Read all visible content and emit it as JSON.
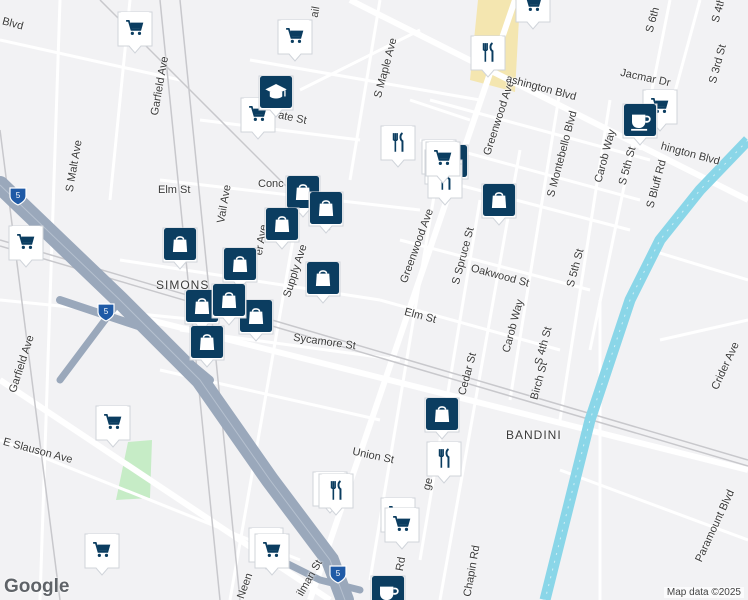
{
  "map": {
    "colors": {
      "background": "#f2f2f4",
      "road": "#ffffff",
      "freeway": "#9aa8bb",
      "river": "#8ad6e8",
      "park": "#c6ecc6",
      "highlight": "#f4e6b0",
      "pin_bg": "#0b3d60"
    },
    "streets": [
      {
        "name": "Garfield Ave",
        "rot": -80
      },
      {
        "name": "S Malt Ave",
        "rot": -80
      },
      {
        "name": "Vail Ave",
        "rot": -80
      },
      {
        "name": "Elm St",
        "rot": 0
      },
      {
        "name": "Conc",
        "rot": 0
      },
      {
        "name": "er Ave",
        "rot": -80
      },
      {
        "name": "Supply Ave",
        "rot": -72
      },
      {
        "name": "Sycamore St",
        "rot": 8
      },
      {
        "name": "Garfield Ave",
        "rot": -72
      },
      {
        "name": "E Slauson Ave",
        "rot": 15
      },
      {
        "name": "S Maple Ave",
        "rot": -75
      },
      {
        "name": "Greenwood Ave",
        "rot": -72
      },
      {
        "name": "Greenwood Ave",
        "rot": -70
      },
      {
        "name": "S Spruce St",
        "rot": -75
      },
      {
        "name": "Oakwood St",
        "rot": 15
      },
      {
        "name": "Elm St",
        "rot": 15
      },
      {
        "name": "Carob Way",
        "rot": -75
      },
      {
        "name": "Cedar St",
        "rot": -75
      },
      {
        "name": "Birch St",
        "rot": -75
      },
      {
        "name": "S 4th St",
        "rot": -75
      },
      {
        "name": "S 5th St",
        "rot": -75
      },
      {
        "name": "S Montebello Blvd",
        "rot": -75
      },
      {
        "name": "Carob Way",
        "rot": -75
      },
      {
        "name": "S 5th St",
        "rot": -75
      },
      {
        "name": "S Bluff Rd",
        "rot": -75
      },
      {
        "name": "Jacmar Dr",
        "rot": 12
      },
      {
        "name": "S 3rd St",
        "rot": -75
      },
      {
        "name": "S 6th",
        "rot": -75
      },
      {
        "name": "S 4th",
        "rot": -75
      },
      {
        "name": "ashington Blvd",
        "rot": 15
      },
      {
        "name": "hington Blvd",
        "rot": 15
      },
      {
        "name": "ate St",
        "rot": 12
      },
      {
        "name": "Union St",
        "rot": 12
      },
      {
        "name": "ge",
        "rot": -75
      },
      {
        "name": "Chapin Rd",
        "rot": -80
      },
      {
        "name": "Rd",
        "rot": -80
      },
      {
        "name": "Crider Ave",
        "rot": -65
      },
      {
        "name": "Paramount Blvd",
        "rot": -65
      },
      {
        "name": "Neen",
        "rot": -70
      },
      {
        "name": "ilman St",
        "rot": -60
      },
      {
        "name": "Blvd",
        "rot": 15
      },
      {
        "name": "ail",
        "rot": -80
      }
    ],
    "areas": [
      "SIMONS",
      "BANDINI"
    ],
    "shields": [
      "5",
      "5",
      "5"
    ],
    "pins": [
      {
        "icon": "cart"
      },
      {
        "icon": "cart"
      },
      {
        "icon": "cart"
      },
      {
        "icon": "cart"
      },
      {
        "icon": "cart"
      },
      {
        "icon": "cart"
      },
      {
        "icon": "cart"
      },
      {
        "icon": "cart"
      },
      {
        "icon": "cart"
      },
      {
        "icon": "cart"
      },
      {
        "icon": "cart"
      },
      {
        "icon": "cart"
      },
      {
        "icon": "grad"
      },
      {
        "icon": "bag"
      },
      {
        "icon": "bag"
      },
      {
        "icon": "bag"
      },
      {
        "icon": "bag"
      },
      {
        "icon": "bag"
      },
      {
        "icon": "bag"
      },
      {
        "icon": "bag"
      },
      {
        "icon": "bag"
      },
      {
        "icon": "bag"
      },
      {
        "icon": "bag"
      },
      {
        "icon": "bag"
      },
      {
        "icon": "bag"
      },
      {
        "icon": "bag"
      },
      {
        "icon": "fork"
      },
      {
        "icon": "fork"
      },
      {
        "icon": "fork"
      },
      {
        "icon": "fork"
      },
      {
        "icon": "fork"
      },
      {
        "icon": "fork"
      },
      {
        "icon": "fork"
      },
      {
        "icon": "fork"
      },
      {
        "icon": "fork"
      },
      {
        "icon": "cup"
      },
      {
        "icon": "cup"
      },
      {
        "icon": "cart"
      }
    ],
    "attribution": {
      "logo": "Google",
      "credit": "Map data ©2025"
    }
  }
}
